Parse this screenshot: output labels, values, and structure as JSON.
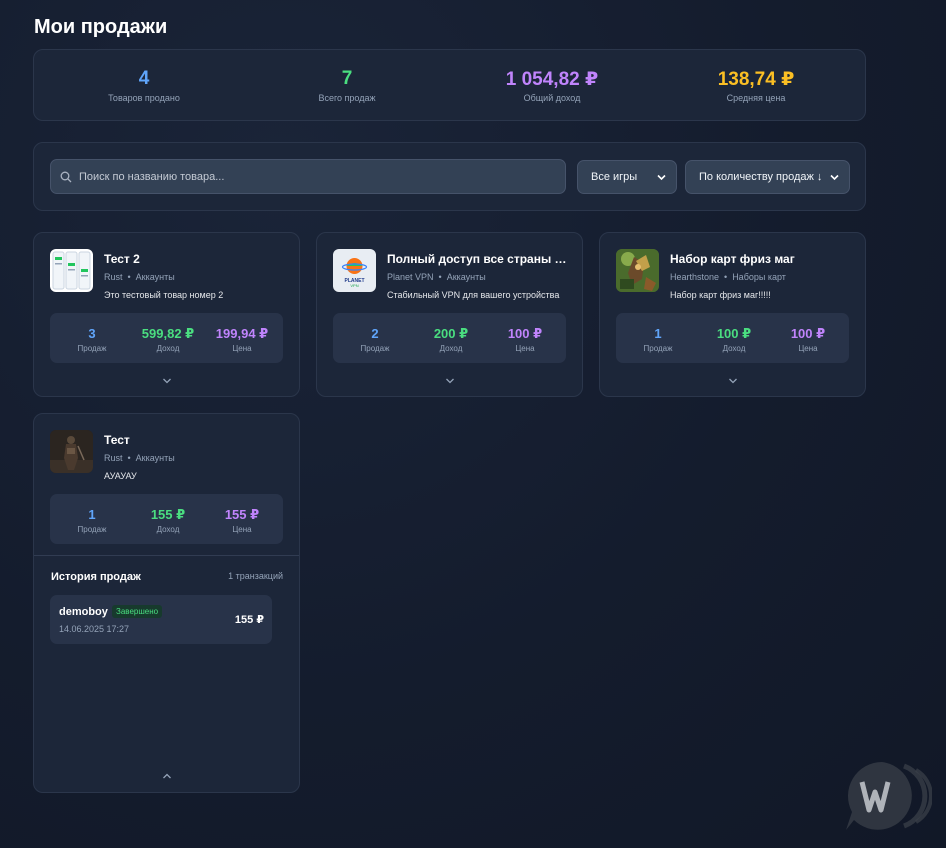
{
  "page_title": "Мои продажи",
  "stats": [
    {
      "value": "4",
      "label": "Товаров продано",
      "color": "#60a5fa"
    },
    {
      "value": "7",
      "label": "Всего продаж",
      "color": "#4ade80"
    },
    {
      "value": "1 054,82 ₽",
      "label": "Общий доход",
      "color": "#c084fc"
    },
    {
      "value": "138,74 ₽",
      "label": "Средняя цена",
      "color": "#fbbf24"
    }
  ],
  "filters": {
    "search_placeholder": "Поиск по названию товара...",
    "game_select": "Все игры",
    "sort_select": "По количеству продаж ↓"
  },
  "mini_labels": {
    "sales": "Продаж",
    "income": "Доход",
    "price": "Цена"
  },
  "products": [
    {
      "name": "Тест 2",
      "game": "Rust",
      "category": "Аккаунты",
      "description": "Это тестовый товар номер 2",
      "sales": "3",
      "income": "599,82 ₽",
      "price": "199,94 ₽",
      "thumb_icon": "app-screenshots-image"
    },
    {
      "name": "Полный доступ все страны (1...",
      "game": "Planet VPN",
      "category": "Аккаунты",
      "description": "Стабильный VPN для вашего устройства",
      "sales": "2",
      "income": "200 ₽",
      "price": "100 ₽",
      "thumb_icon": "planet-vpn-logo"
    },
    {
      "name": "Набор карт фриз маг",
      "game": "Hearthstone",
      "category": "Наборы карт",
      "description": "Набор карт фриз маг!!!!!",
      "sales": "1",
      "income": "100 ₽",
      "price": "100 ₽",
      "thumb_icon": "hearthstone-card-art"
    },
    {
      "name": "Тест",
      "game": "Rust",
      "category": "Аккаунты",
      "description": "АУАУАУ",
      "sales": "1",
      "income": "155 ₽",
      "price": "155 ₽",
      "thumb_icon": "rust-character-art",
      "history": {
        "title": "История продаж",
        "count": "1 транзакций",
        "transactions": [
          {
            "user": "demoboy",
            "status": "Завершено",
            "date": "14.06.2025 17:27",
            "amount": "155 ₽"
          }
        ]
      }
    }
  ]
}
